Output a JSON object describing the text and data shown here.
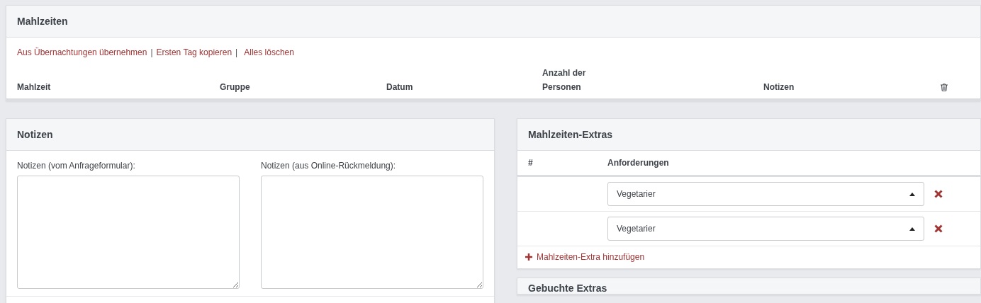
{
  "meals": {
    "title": "Mahlzeiten",
    "actions": [
      "Aus Übernachtungen übernehmen",
      "Ersten Tag kopieren",
      "Alles löschen"
    ],
    "separator": "|",
    "columns": [
      "Mahlzeit",
      "Gruppe",
      "Datum",
      "Anzahl der Personen",
      "Notizen"
    ]
  },
  "notes": {
    "title": "Notizen",
    "fields": [
      {
        "label": "Notizen (vom Anfrageformular):"
      },
      {
        "label": "Notizen (aus Online-Rückmeldung):"
      }
    ]
  },
  "meal_extras": {
    "title": "Mahlzeiten-Extras",
    "columns": [
      "#",
      "Anforderungen"
    ],
    "rows": [
      {
        "value": "Vegetarier"
      },
      {
        "value": "Vegetarier"
      }
    ],
    "add_link": "Mahlzeiten-Extra hinzufügen"
  },
  "booked_extras": {
    "title": "Gebuchte Extras"
  }
}
